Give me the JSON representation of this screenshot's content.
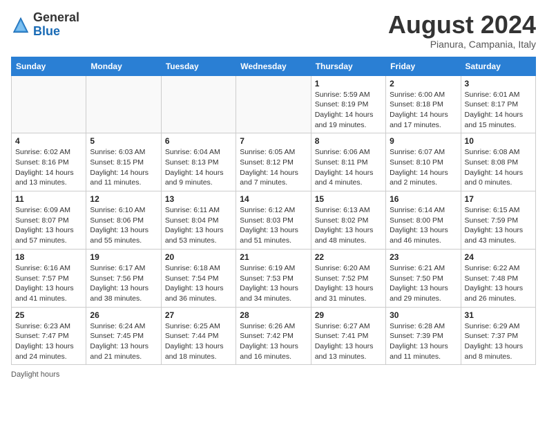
{
  "header": {
    "logo_general": "General",
    "logo_blue": "Blue",
    "month_year": "August 2024",
    "location": "Pianura, Campania, Italy"
  },
  "weekdays": [
    "Sunday",
    "Monday",
    "Tuesday",
    "Wednesday",
    "Thursday",
    "Friday",
    "Saturday"
  ],
  "weeks": [
    [
      {
        "day": "",
        "info": ""
      },
      {
        "day": "",
        "info": ""
      },
      {
        "day": "",
        "info": ""
      },
      {
        "day": "",
        "info": ""
      },
      {
        "day": "1",
        "info": "Sunrise: 5:59 AM\nSunset: 8:19 PM\nDaylight: 14 hours\nand 19 minutes."
      },
      {
        "day": "2",
        "info": "Sunrise: 6:00 AM\nSunset: 8:18 PM\nDaylight: 14 hours\nand 17 minutes."
      },
      {
        "day": "3",
        "info": "Sunrise: 6:01 AM\nSunset: 8:17 PM\nDaylight: 14 hours\nand 15 minutes."
      }
    ],
    [
      {
        "day": "4",
        "info": "Sunrise: 6:02 AM\nSunset: 8:16 PM\nDaylight: 14 hours\nand 13 minutes."
      },
      {
        "day": "5",
        "info": "Sunrise: 6:03 AM\nSunset: 8:15 PM\nDaylight: 14 hours\nand 11 minutes."
      },
      {
        "day": "6",
        "info": "Sunrise: 6:04 AM\nSunset: 8:13 PM\nDaylight: 14 hours\nand 9 minutes."
      },
      {
        "day": "7",
        "info": "Sunrise: 6:05 AM\nSunset: 8:12 PM\nDaylight: 14 hours\nand 7 minutes."
      },
      {
        "day": "8",
        "info": "Sunrise: 6:06 AM\nSunset: 8:11 PM\nDaylight: 14 hours\nand 4 minutes."
      },
      {
        "day": "9",
        "info": "Sunrise: 6:07 AM\nSunset: 8:10 PM\nDaylight: 14 hours\nand 2 minutes."
      },
      {
        "day": "10",
        "info": "Sunrise: 6:08 AM\nSunset: 8:08 PM\nDaylight: 14 hours\nand 0 minutes."
      }
    ],
    [
      {
        "day": "11",
        "info": "Sunrise: 6:09 AM\nSunset: 8:07 PM\nDaylight: 13 hours\nand 57 minutes."
      },
      {
        "day": "12",
        "info": "Sunrise: 6:10 AM\nSunset: 8:06 PM\nDaylight: 13 hours\nand 55 minutes."
      },
      {
        "day": "13",
        "info": "Sunrise: 6:11 AM\nSunset: 8:04 PM\nDaylight: 13 hours\nand 53 minutes."
      },
      {
        "day": "14",
        "info": "Sunrise: 6:12 AM\nSunset: 8:03 PM\nDaylight: 13 hours\nand 51 minutes."
      },
      {
        "day": "15",
        "info": "Sunrise: 6:13 AM\nSunset: 8:02 PM\nDaylight: 13 hours\nand 48 minutes."
      },
      {
        "day": "16",
        "info": "Sunrise: 6:14 AM\nSunset: 8:00 PM\nDaylight: 13 hours\nand 46 minutes."
      },
      {
        "day": "17",
        "info": "Sunrise: 6:15 AM\nSunset: 7:59 PM\nDaylight: 13 hours\nand 43 minutes."
      }
    ],
    [
      {
        "day": "18",
        "info": "Sunrise: 6:16 AM\nSunset: 7:57 PM\nDaylight: 13 hours\nand 41 minutes."
      },
      {
        "day": "19",
        "info": "Sunrise: 6:17 AM\nSunset: 7:56 PM\nDaylight: 13 hours\nand 38 minutes."
      },
      {
        "day": "20",
        "info": "Sunrise: 6:18 AM\nSunset: 7:54 PM\nDaylight: 13 hours\nand 36 minutes."
      },
      {
        "day": "21",
        "info": "Sunrise: 6:19 AM\nSunset: 7:53 PM\nDaylight: 13 hours\nand 34 minutes."
      },
      {
        "day": "22",
        "info": "Sunrise: 6:20 AM\nSunset: 7:52 PM\nDaylight: 13 hours\nand 31 minutes."
      },
      {
        "day": "23",
        "info": "Sunrise: 6:21 AM\nSunset: 7:50 PM\nDaylight: 13 hours\nand 29 minutes."
      },
      {
        "day": "24",
        "info": "Sunrise: 6:22 AM\nSunset: 7:48 PM\nDaylight: 13 hours\nand 26 minutes."
      }
    ],
    [
      {
        "day": "25",
        "info": "Sunrise: 6:23 AM\nSunset: 7:47 PM\nDaylight: 13 hours\nand 24 minutes."
      },
      {
        "day": "26",
        "info": "Sunrise: 6:24 AM\nSunset: 7:45 PM\nDaylight: 13 hours\nand 21 minutes."
      },
      {
        "day": "27",
        "info": "Sunrise: 6:25 AM\nSunset: 7:44 PM\nDaylight: 13 hours\nand 18 minutes."
      },
      {
        "day": "28",
        "info": "Sunrise: 6:26 AM\nSunset: 7:42 PM\nDaylight: 13 hours\nand 16 minutes."
      },
      {
        "day": "29",
        "info": "Sunrise: 6:27 AM\nSunset: 7:41 PM\nDaylight: 13 hours\nand 13 minutes."
      },
      {
        "day": "30",
        "info": "Sunrise: 6:28 AM\nSunset: 7:39 PM\nDaylight: 13 hours\nand 11 minutes."
      },
      {
        "day": "31",
        "info": "Sunrise: 6:29 AM\nSunset: 7:37 PM\nDaylight: 13 hours\nand 8 minutes."
      }
    ]
  ],
  "footer": {
    "daylight_label": "Daylight hours"
  }
}
